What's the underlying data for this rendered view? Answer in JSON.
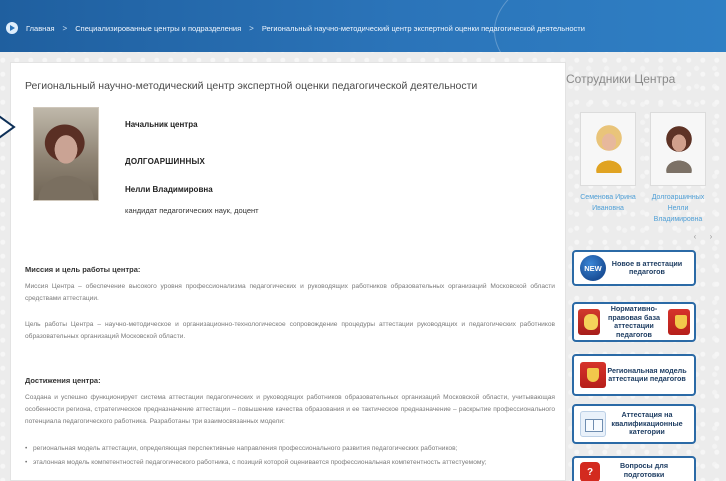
{
  "breadcrumb": {
    "items": [
      "Главная",
      "Специализированные центры и подразделения",
      "Региональный научно-методический центр экспертной оценки педагогической деятельности"
    ]
  },
  "main": {
    "title": "Региональный научно-методический центр экспертной оценки педагогической деятельности",
    "head": {
      "role": "Начальник центра",
      "surname": "ДОЛГОАРШИННЫХ",
      "name": "Нелли Владимировна",
      "degree": "кандидат педагогических наук, доцент"
    },
    "mission": {
      "title": "Миссия и цель работы центра:",
      "para1": "Миссия Центра – обеспечение высокого уровня профессионализма педагогических и руководящих работников образовательных организаций Московской области средствами аттестации.",
      "para2": "Цель работы Центра – научно-методическое и организационно-технологическое сопровождение процедуры аттестации руководящих и педагогических работников образовательных организаций Московской области."
    },
    "achievements": {
      "title": "Достижения центра:",
      "para": "Создана и успешно функционирует система аттестации педагогических и руководящих работников образовательных организаций Московской области, учитывающая особенности региона, стратегическое предназначение аттестации – повышение качества образования и ее тактическое предназначение – раскрытие профессионального потенциала педагогического работника. Разработаны три взаимосвязанных модели:",
      "bullets": [
        "региональная модель аттестации, определяющая перспективные направления профессионального развития педагогических работников;",
        "эталонная модель компетентностей педагогического работника, с позиций которой оценивается профессиональная компетентность аттестуемому;"
      ]
    }
  },
  "sidebar": {
    "title": "Сотрудники Центра",
    "staff": [
      {
        "name": "Семенова Ирина Ивановна"
      },
      {
        "name": "Долгоаршинных Нелли Владимировна"
      }
    ],
    "carousel": {
      "prev": "‹",
      "next": "›"
    },
    "promos": [
      {
        "label": "Новое в аттестации педагогов",
        "icon_text": "NEW"
      },
      {
        "label": "Нормативно-правовая база аттестации педагогов"
      },
      {
        "label": "Региональная модель аттестации педагогов"
      },
      {
        "label": "Аттестация на квалификационные категории"
      },
      {
        "label": "Вопросы для подготовки",
        "icon_text": "?"
      }
    ]
  }
}
